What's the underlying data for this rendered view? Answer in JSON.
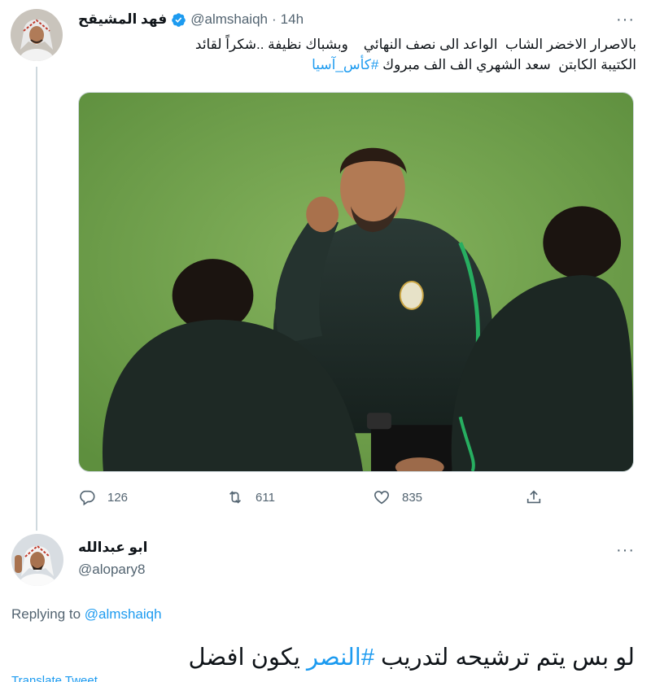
{
  "tweet1": {
    "display_name": "فهد المشيقح",
    "handle": "@almshaiqh",
    "dot": "·",
    "time": "14h",
    "more": "···",
    "text_lines": [
      "بالاصرار الاخضر الشاب  الواعد الى نصف النهائي    وبشباك نظيفة ..شكراً لقائد",
      "الكتيبة الكابتن  سعد الشهري الف الف مبروك"
    ],
    "hashtag": "#كأس_آسيا",
    "actions": {
      "reply_count": "126",
      "retweet_count": "611",
      "like_count": "835"
    }
  },
  "tweet2": {
    "display_name": "ابو عبدالله",
    "handle": "@alopary8",
    "more": "···",
    "replying_prefix": "Replying to",
    "replying_mention": "@almshaiqh",
    "text_before": "لو بس يتم ترشيحه لتدريب ",
    "hashtag": "#النصر",
    "text_after": " يكون افضل",
    "translate": "Translate Tweet"
  },
  "colors": {
    "link_blue": "#1d9bf0",
    "secondary_text": "#536471",
    "primary_text": "#0f1419",
    "thread_line": "#cfd9de",
    "pitch_green": "#6fa14a"
  },
  "icons": {
    "verified": "verified-badge-icon",
    "reply": "reply-icon",
    "retweet": "retweet-icon",
    "like": "heart-icon",
    "share": "share-icon"
  }
}
